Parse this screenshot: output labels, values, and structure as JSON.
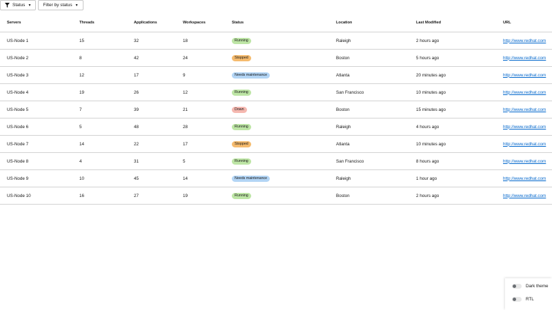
{
  "toolbar": {
    "status_label": "Status",
    "filter_label": "Filter by status"
  },
  "table": {
    "headers": [
      "Servers",
      "Threads",
      "Applications",
      "Workspaces",
      "Status",
      "Location",
      "Last Modified",
      "URL"
    ],
    "rows": [
      {
        "server": "US-Node 1",
        "threads": "15",
        "applications": "32",
        "workspaces": "18",
        "status": "Running",
        "location": "Raleigh",
        "modified": "2 hours ago",
        "url": "http://www.redhat.com"
      },
      {
        "server": "US-Node 2",
        "threads": "8",
        "applications": "42",
        "workspaces": "24",
        "status": "Stopped",
        "location": "Boston",
        "modified": "5 hours ago",
        "url": "http://www.redhat.com"
      },
      {
        "server": "US-Node 3",
        "threads": "12",
        "applications": "17",
        "workspaces": "9",
        "status": "Needs maintenance",
        "location": "Atlanta",
        "modified": "20 minutes ago",
        "url": "http://www.redhat.com"
      },
      {
        "server": "US-Node 4",
        "threads": "19",
        "applications": "26",
        "workspaces": "12",
        "status": "Running",
        "location": "San Francisco",
        "modified": "10 minutes ago",
        "url": "http://www.redhat.com"
      },
      {
        "server": "US-Node 5",
        "threads": "7",
        "applications": "39",
        "workspaces": "21",
        "status": "Down",
        "location": "Boston",
        "modified": "15 minutes ago",
        "url": "http://www.redhat.com"
      },
      {
        "server": "US-Node 6",
        "threads": "5",
        "applications": "48",
        "workspaces": "28",
        "status": "Running",
        "location": "Raleigh",
        "modified": "4 hours ago",
        "url": "http://www.redhat.com"
      },
      {
        "server": "US-Node 7",
        "threads": "14",
        "applications": "22",
        "workspaces": "17",
        "status": "Stopped",
        "location": "Atlanta",
        "modified": "10 minutes ago",
        "url": "http://www.redhat.com"
      },
      {
        "server": "US-Node 8",
        "threads": "4",
        "applications": "31",
        "workspaces": "5",
        "status": "Running",
        "location": "San Francisco",
        "modified": "8 hours ago",
        "url": "http://www.redhat.com"
      },
      {
        "server": "US-Node 9",
        "threads": "10",
        "applications": "45",
        "workspaces": "14",
        "status": "Needs maintenance",
        "location": "Raleigh",
        "modified": "1 hour ago",
        "url": "http://www.redhat.com"
      },
      {
        "server": "US-Node 10",
        "threads": "16",
        "applications": "27",
        "workspaces": "19",
        "status": "Running",
        "location": "Boston",
        "modified": "2 hours ago",
        "url": "http://www.redhat.com"
      }
    ]
  },
  "settings": {
    "dark_theme_label": "Dark theme",
    "rtl_label": "RTL"
  }
}
